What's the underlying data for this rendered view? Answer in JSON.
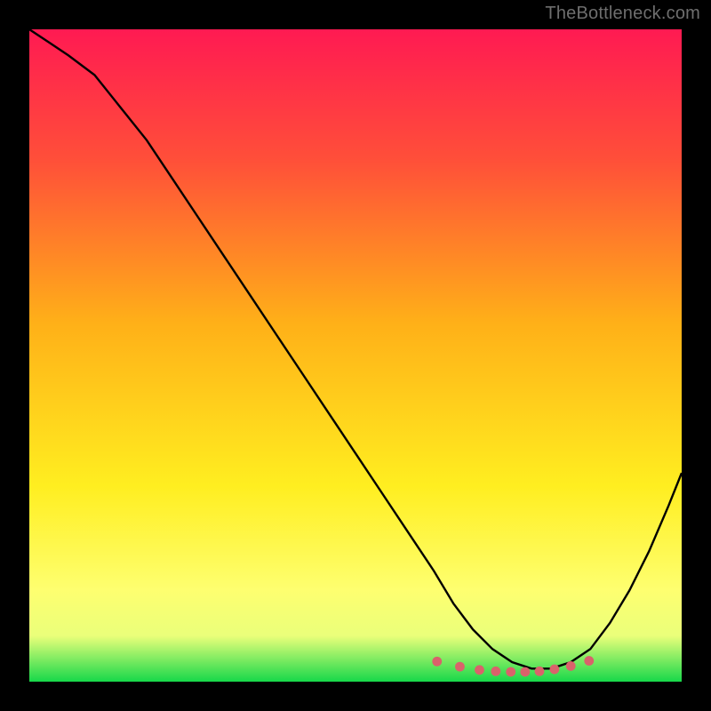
{
  "watermark": "TheBottleneck.com",
  "chart_data": {
    "type": "line",
    "title": "",
    "xlabel": "",
    "ylabel": "",
    "xlim": [
      0,
      100
    ],
    "ylim": [
      0,
      100
    ],
    "gradient_stops": [
      {
        "offset": 0.0,
        "color": "#ff1a52"
      },
      {
        "offset": 0.2,
        "color": "#ff4f39"
      },
      {
        "offset": 0.45,
        "color": "#ffb018"
      },
      {
        "offset": 0.7,
        "color": "#ffee20"
      },
      {
        "offset": 0.86,
        "color": "#feff70"
      },
      {
        "offset": 0.93,
        "color": "#eaff7a"
      },
      {
        "offset": 1.0,
        "color": "#17d84a"
      }
    ],
    "series": [
      {
        "name": "bottleneck-curve",
        "color": "#000000",
        "x": [
          0,
          3,
          6,
          10,
          14,
          18,
          22,
          26,
          30,
          34,
          38,
          42,
          46,
          50,
          54,
          58,
          62,
          65,
          68,
          71,
          74,
          77,
          80,
          83,
          86,
          89,
          92,
          95,
          98,
          100
        ],
        "values": [
          100,
          98,
          96,
          93,
          88,
          83,
          77,
          71,
          65,
          59,
          53,
          47,
          41,
          35,
          29,
          23,
          17,
          12,
          8,
          5,
          3,
          2,
          2,
          3,
          5,
          9,
          14,
          20,
          27,
          32
        ]
      }
    ],
    "markers": {
      "name": "optimal-zone-dots",
      "color": "#d9626b",
      "x": [
        62.5,
        66.0,
        69.0,
        71.5,
        73.8,
        76.0,
        78.2,
        80.5,
        83.0,
        85.8
      ],
      "values": [
        3.1,
        2.3,
        1.8,
        1.6,
        1.5,
        1.5,
        1.6,
        1.9,
        2.4,
        3.2
      ]
    }
  }
}
